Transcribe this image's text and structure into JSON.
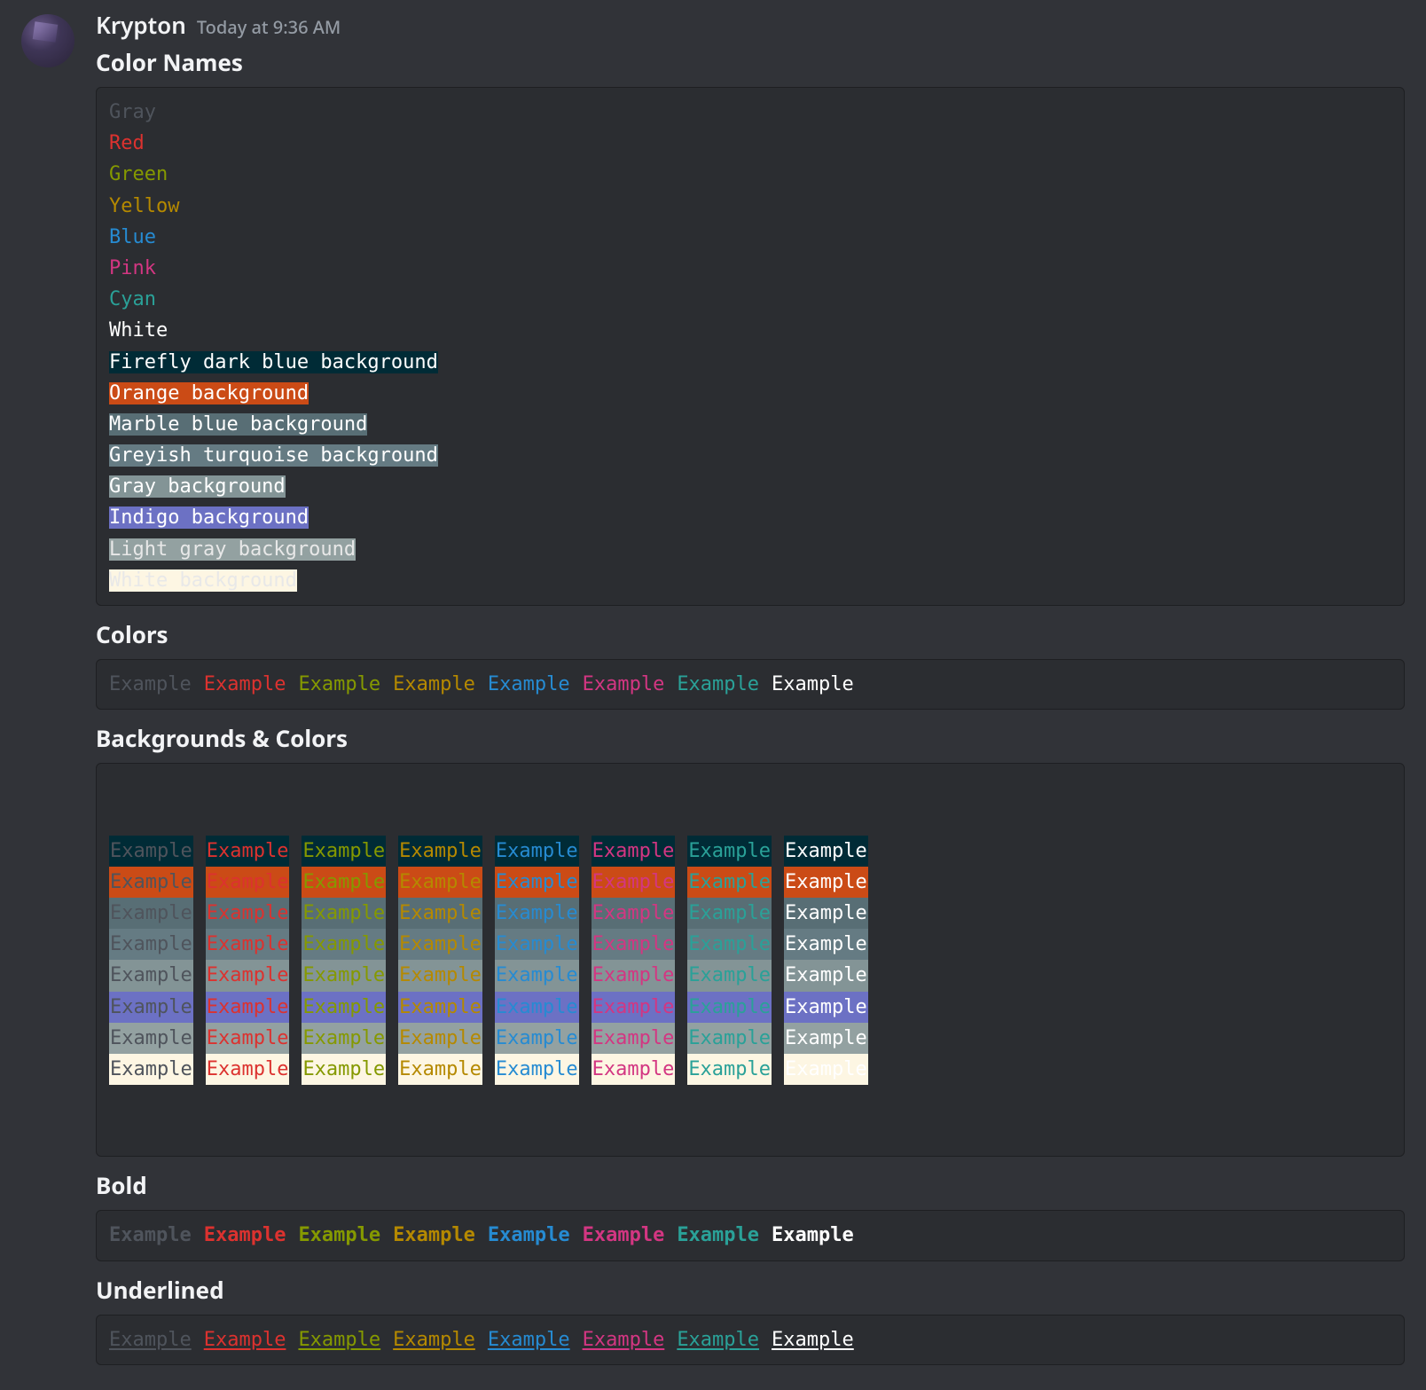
{
  "author": {
    "name": "Krypton",
    "timestamp": "Today at 9:36 AM"
  },
  "sections": {
    "color_names": "Color Names",
    "colors": "Colors",
    "bg_colors": "Backgrounds & Colors",
    "bold": "Bold",
    "underlined": "Underlined"
  },
  "palette": {
    "fg": [
      "#4f545c",
      "#dc322f",
      "#859900",
      "#b58900",
      "#268bd2",
      "#d33682",
      "#2aa198",
      "#ffffff"
    ],
    "bg": [
      "#002b36",
      "#cb4b16",
      "#586e75",
      "#657b83",
      "#839496",
      "#6c71c4",
      "#93a1a1",
      "#fdf6e3"
    ]
  },
  "color_name_lines": [
    {
      "text": "Gray",
      "fg": 0
    },
    {
      "text": "Red",
      "fg": 1
    },
    {
      "text": "Green",
      "fg": 2
    },
    {
      "text": "Yellow",
      "fg": 3
    },
    {
      "text": "Blue",
      "fg": 4
    },
    {
      "text": "Pink",
      "fg": 5
    },
    {
      "text": "Cyan",
      "fg": 6
    },
    {
      "text": "White",
      "fg": 7
    },
    {
      "text": "Firefly dark blue background",
      "bg": 0,
      "on": "onbg"
    },
    {
      "text": "Orange background",
      "bg": 1,
      "on": "onbg"
    },
    {
      "text": "Marble blue background",
      "bg": 2,
      "on": "onbg"
    },
    {
      "text": "Greyish turquoise background",
      "bg": 3,
      "on": "onbg"
    },
    {
      "text": "Gray background",
      "bg": 4,
      "on": "onbg"
    },
    {
      "text": "Indigo background",
      "bg": 5,
      "on": "onbg"
    },
    {
      "text": "Light gray background",
      "bg": 6,
      "on": "onbglight"
    },
    {
      "text": "White background",
      "bg": 7,
      "on": "onbglight"
    }
  ],
  "example_word": "Example",
  "fg_order": [
    0,
    1,
    2,
    3,
    4,
    5,
    6,
    7
  ],
  "bg_order": [
    0,
    1,
    2,
    3,
    4,
    5,
    6,
    7
  ]
}
